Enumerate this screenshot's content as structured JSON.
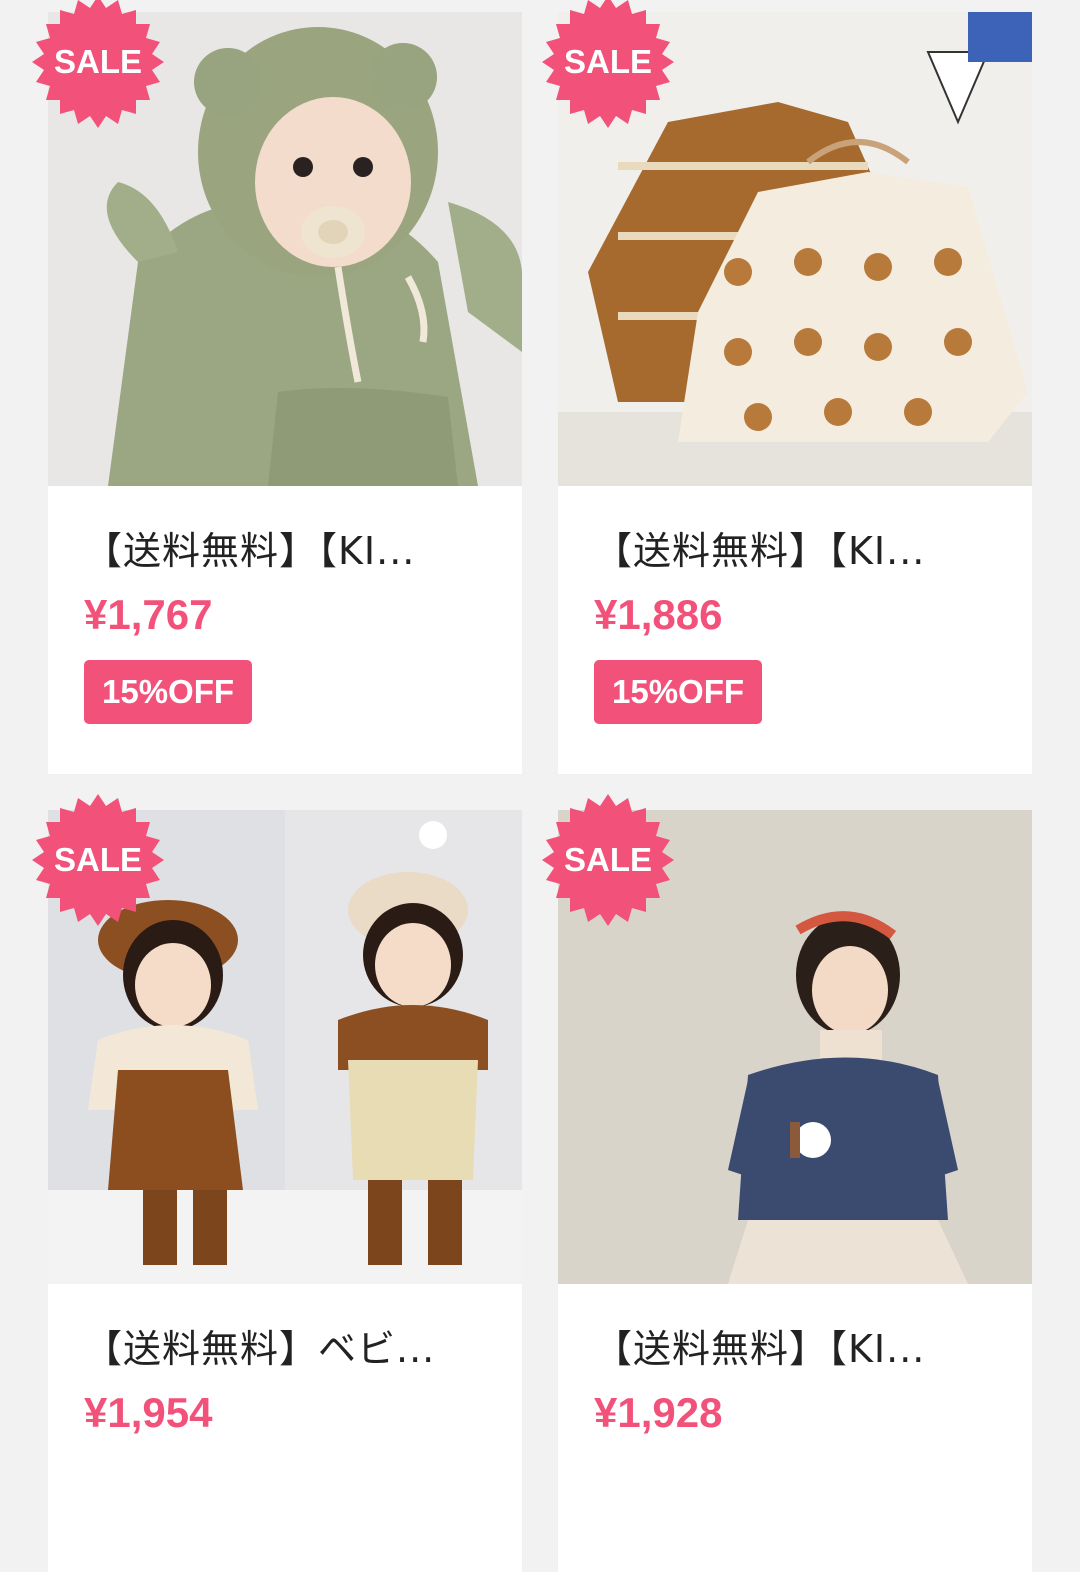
{
  "colors": {
    "accent": "#f2527a",
    "background": "#f2f2f2",
    "card": "#ffffff",
    "title_text": "#222222"
  },
  "products": [
    {
      "badge": "SALE",
      "title": "【送料無料】【KI...",
      "price": "¥1,767",
      "discount": "15%OFF",
      "image_icon": "baby-bear-hoodie-photo"
    },
    {
      "badge": "SALE",
      "title": "【送料無料】【KI...",
      "price": "¥1,886",
      "discount": "15%OFF",
      "image_icon": "bear-knit-cardigans-photo"
    },
    {
      "badge": "SALE",
      "title": "【送料無料】ベビ...",
      "price": "¥1,954",
      "image_icon": "toddler-overalls-hats-photo"
    },
    {
      "badge": "SALE",
      "title": "【送料無料】【KI...",
      "price": "¥1,928",
      "image_icon": "girl-navy-cardigan-photo"
    }
  ]
}
